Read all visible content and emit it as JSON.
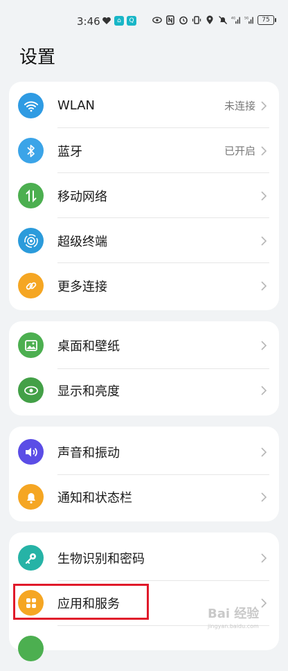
{
  "status_bar": {
    "time": "3:46",
    "battery": "75",
    "network_1": "4G",
    "network_2": "5G"
  },
  "page": {
    "title": "设置"
  },
  "groups": [
    {
      "items": [
        {
          "label": "WLAN",
          "value": "未连接",
          "icon": "wifi-icon",
          "color": "#2f9be3"
        },
        {
          "label": "蓝牙",
          "value": "已开启",
          "icon": "bluetooth-icon",
          "color": "#3ba4e8"
        },
        {
          "label": "移动网络",
          "value": "",
          "icon": "mobile-data-icon",
          "color": "#4caf50"
        },
        {
          "label": "超级终端",
          "value": "",
          "icon": "super-device-icon",
          "color": "#2b9bdb"
        },
        {
          "label": "更多连接",
          "value": "",
          "icon": "link-icon",
          "color": "#f5a623"
        }
      ]
    },
    {
      "items": [
        {
          "label": "桌面和壁纸",
          "value": "",
          "icon": "wallpaper-icon",
          "color": "#4caf50"
        },
        {
          "label": "显示和亮度",
          "value": "",
          "icon": "eye-icon",
          "color": "#43a047"
        }
      ]
    },
    {
      "items": [
        {
          "label": "声音和振动",
          "value": "",
          "icon": "volume-icon",
          "color": "#5b4de6"
        },
        {
          "label": "通知和状态栏",
          "value": "",
          "icon": "bell-icon",
          "color": "#f5a623"
        }
      ]
    },
    {
      "items": [
        {
          "label": "生物识别和密码",
          "value": "",
          "icon": "key-icon",
          "color": "#26b3a6"
        },
        {
          "label": "应用和服务",
          "value": "",
          "icon": "apps-icon",
          "color": "#f5a623"
        }
      ]
    }
  ],
  "watermark": {
    "text": "Bai 经验",
    "sub": "jingyan.baidu.com"
  }
}
